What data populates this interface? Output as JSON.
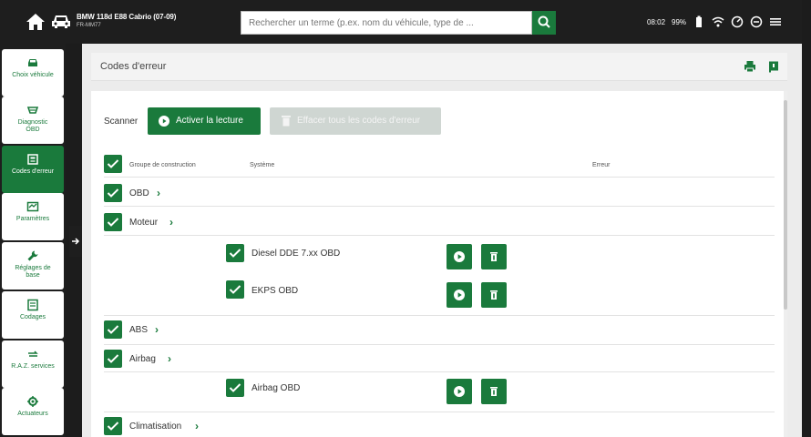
{
  "topbar": {
    "vehicle_title": "BMW 118d E88 Cabrio (07-09)",
    "vehicle_plate": "FR-MM77",
    "search_placeholder": "Rechercher un terme (p.ex. nom du véhicule, type de ...",
    "time": "08:02",
    "battery": "99%"
  },
  "sidebar": {
    "items": [
      {
        "label": "Choix véhicule",
        "icon": "car-icon"
      },
      {
        "label": "Diagnostic OBD",
        "icon": "obd-icon"
      },
      {
        "label": "Codes d'erreur",
        "icon": "error-codes-icon",
        "active": true
      },
      {
        "label": "Paramètres",
        "icon": "parameters-icon"
      },
      {
        "label": "Réglages de base",
        "icon": "wrench-icon"
      },
      {
        "label": "Codages",
        "icon": "coding-icon"
      },
      {
        "label": "R.A.Z. services",
        "icon": "service-reset-icon"
      },
      {
        "label": "Actuateurs",
        "icon": "actuators-icon"
      }
    ]
  },
  "main": {
    "page_title": "Codes d'erreur",
    "scanner_label": "Scanner",
    "read_button": "Activer la lecture",
    "clear_button": "Effacer tous les codes d'erreur",
    "columns": {
      "group": "Groupe de construction",
      "system": "Système",
      "error": "Erreur"
    },
    "groups": [
      {
        "label": "OBD",
        "systems": []
      },
      {
        "label": "Moteur",
        "systems": [
          "Diesel DDE 7.xx OBD",
          "EKPS OBD"
        ]
      },
      {
        "label": "ABS",
        "systems": []
      },
      {
        "label": "Airbag",
        "systems": [
          "Airbag OBD"
        ]
      },
      {
        "label": "Climatisation",
        "systems": []
      }
    ]
  },
  "colors": {
    "accent": "#1a7a3c",
    "topbar": "#1e1e1e",
    "disabled_button": "#cfd6d2"
  }
}
